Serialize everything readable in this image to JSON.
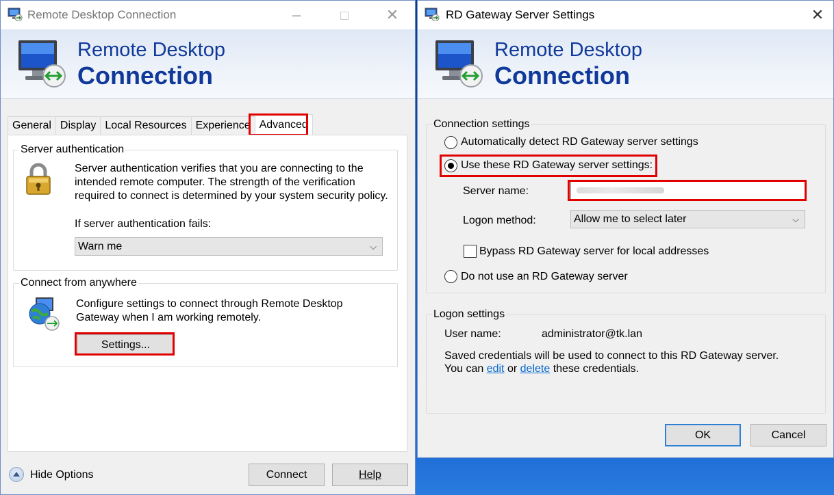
{
  "colors": {
    "accent": "#10399a",
    "highlight": "#e00000",
    "link": "#0066cc",
    "default_button": "#2f7fd6"
  },
  "main_window": {
    "title": "Remote Desktop Connection",
    "title_icon": "remote-desktop-icon",
    "banner": {
      "line1": "Remote Desktop",
      "line2": "Connection",
      "icon": "monitor-remote-icon"
    },
    "tabs": [
      {
        "label": "General",
        "active": false
      },
      {
        "label": "Display",
        "active": false
      },
      {
        "label": "Local Resources",
        "active": false
      },
      {
        "label": "Experience",
        "active": false
      },
      {
        "label": "Advanced",
        "active": true
      }
    ],
    "server_auth": {
      "legend": "Server authentication",
      "icon": "padlock-icon",
      "description": "Server authentication verifies that you are connecting to the intended remote computer. The strength of the verification required to connect is determined by your system security policy.",
      "fail_label": "If server authentication fails:",
      "fail_value": "Warn me"
    },
    "connect_anywhere": {
      "legend": "Connect from anywhere",
      "icon": "globe-remote-icon",
      "description": "Configure settings to connect through Remote Desktop Gateway when I am working remotely.",
      "settings_button": "Settings..."
    },
    "footer": {
      "hide_options": "Hide Options",
      "connect": "Connect",
      "help": "Help"
    }
  },
  "gateway_window": {
    "title": "RD Gateway Server Settings",
    "banner": {
      "line1": "Remote Desktop",
      "line2": "Connection"
    },
    "connection_settings": {
      "legend": "Connection settings",
      "auto_detect": "Automatically detect RD Gateway server settings",
      "use_these": "Use these RD Gateway server settings:",
      "server_name_label": "Server name:",
      "server_name_value": "",
      "logon_method_label": "Logon method:",
      "logon_method_value": "Allow me to select later",
      "bypass": "Bypass RD Gateway server for local addresses",
      "do_not_use": "Do not use an RD Gateway server",
      "selected": "use_these"
    },
    "logon_settings": {
      "legend": "Logon settings",
      "user_name_label": "User name:",
      "user_name_value": "administrator@tk.lan",
      "saved_line1": "Saved credentials will be used to connect to this RD Gateway server.",
      "saved_prefix": "You can",
      "edit_link": "edit",
      "or_text": "or",
      "delete_link": "delete",
      "saved_suffix": "these credentials."
    },
    "ok": "OK",
    "cancel": "Cancel"
  }
}
